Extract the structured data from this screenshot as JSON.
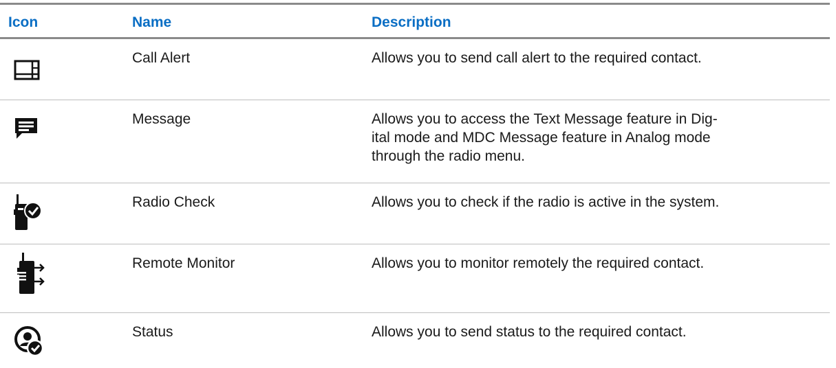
{
  "table": {
    "headers": {
      "icon": "Icon",
      "name": "Name",
      "description": "Description"
    },
    "rows": [
      {
        "icon": "call-alert-icon",
        "name": "Call Alert",
        "description_lines": [
          "Allows you to send call alert to the required contact."
        ]
      },
      {
        "icon": "message-icon",
        "name": "Message",
        "description_lines": [
          "Allows you to access the Text Message feature in Dig-",
          "ital mode and MDC Message feature in Analog mode",
          "through the radio menu."
        ]
      },
      {
        "icon": "radio-check-icon",
        "name": "Radio Check",
        "description_lines": [
          "Allows you to check if the radio is active in the system."
        ]
      },
      {
        "icon": "remote-monitor-icon",
        "name": "Remote Monitor",
        "description_lines": [
          "Allows you to monitor remotely the required contact."
        ]
      },
      {
        "icon": "status-icon",
        "name": "Status",
        "description_lines": [
          "Allows you to send status to the required contact."
        ]
      }
    ]
  },
  "colors": {
    "header_text": "#0a6ec4",
    "rule": "#8a8a8a",
    "row_divider": "#bdbdbd",
    "icon": "#111111"
  }
}
